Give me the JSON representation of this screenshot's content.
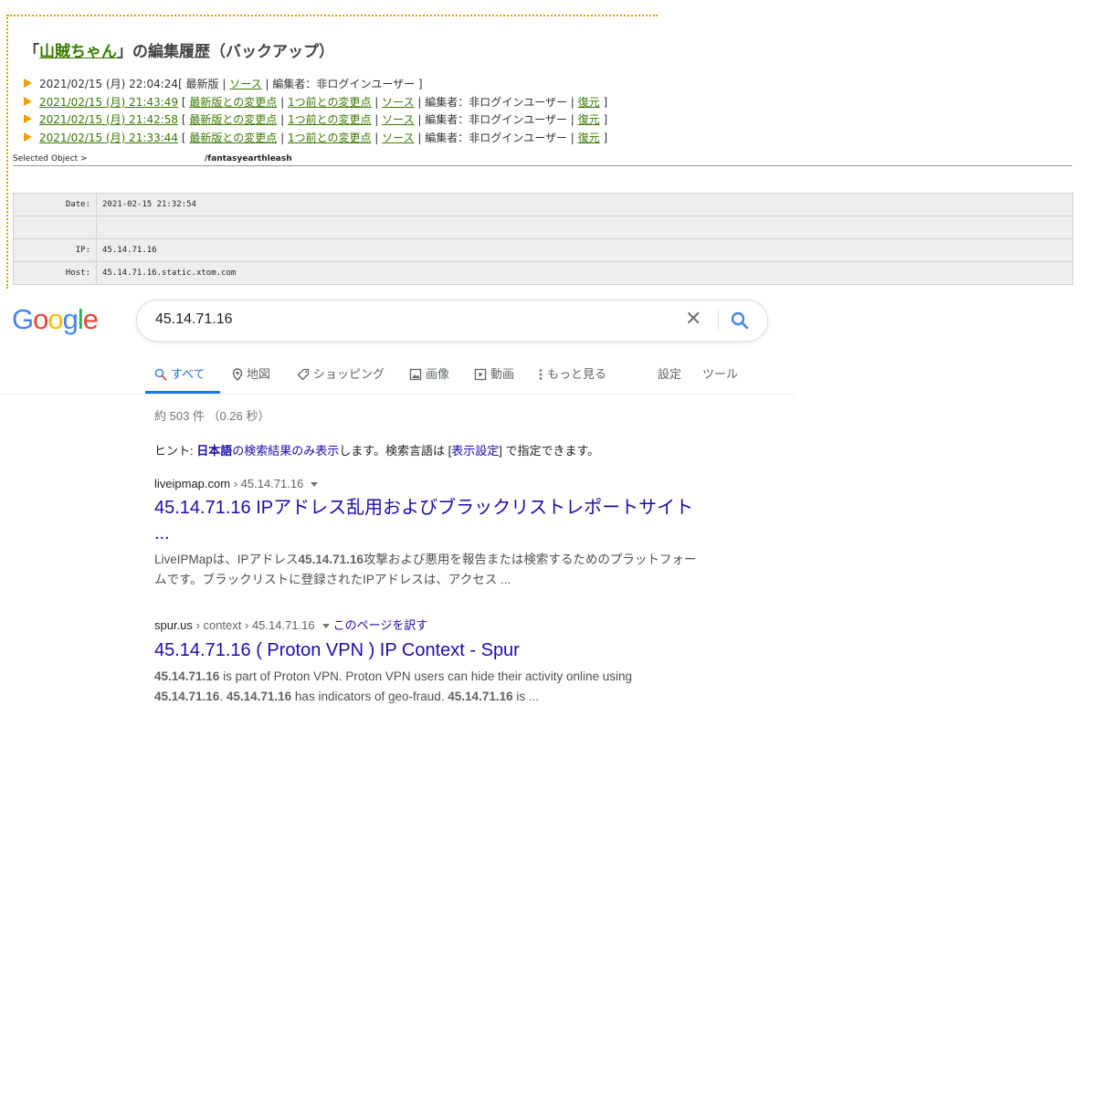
{
  "wiki": {
    "title_prefix": "「",
    "title_link": "山賊ちゃん",
    "title_suffix": "」の編集履歴（バックアップ）",
    "history": [
      {
        "date": "2021/02/15 (月) 22:04:24",
        "date_linked": false,
        "text": "[ 最新版 | ",
        "diff_latest": "",
        "sep1": "",
        "diff_prev": "",
        "sep2": "",
        "source": "ソース",
        "editor": " | 編集者：非ログインユーザー ]",
        "restore": ""
      },
      {
        "date": "2021/02/15 (月) 21:43:49",
        "date_linked": true,
        "text": " [ ",
        "diff_latest": "最新版との変更点",
        "sep1": " | ",
        "diff_prev": "1つ前との変更点",
        "sep2": " | ",
        "source": "ソース",
        "editor": " | 編集者：非ログインユーザー | ",
        "restore": "復元"
      },
      {
        "date": "2021/02/15 (月) 21:42:58",
        "date_linked": true,
        "text": " [ ",
        "diff_latest": "最新版との変更点",
        "sep1": " | ",
        "diff_prev": "1つ前との変更点",
        "sep2": " | ",
        "source": "ソース",
        "editor": " | 編集者：非ログインユーザー | ",
        "restore": "復元"
      },
      {
        "date": "2021/02/15 (月) 21:33:44",
        "date_linked": true,
        "text": " [ ",
        "diff_latest": "最新版との変更点",
        "sep1": " | ",
        "diff_prev": "1つ前との変更点",
        "sep2": " | ",
        "source": "ソース",
        "editor": " | 編集者：非ログインユーザー | ",
        "restore": "復元"
      }
    ],
    "selected_object_label": "Selected Object >",
    "selected_object_value": "/fantasyearthleash",
    "info_rows": [
      {
        "key": "Date:",
        "value": "2021-02-15 21:32:54"
      },
      {
        "key": "",
        "value": ""
      },
      {
        "key": "IP:",
        "value": "45.14.71.16"
      },
      {
        "key": "Host:",
        "value": "45.14.71.16.static.xtom.com"
      }
    ]
  },
  "google": {
    "logo_letters": [
      "G",
      "o",
      "o",
      "g",
      "l",
      "e"
    ],
    "logo_colors": [
      "#4285F4",
      "#EA4335",
      "#FBBC05",
      "#4285F4",
      "#34A853",
      "#EA4335"
    ],
    "query": "45.14.71.16",
    "tabs": [
      {
        "label": "すべて",
        "icon": "search-icon"
      },
      {
        "label": "地図",
        "icon": "map-pin-icon"
      },
      {
        "label": "ショッピング",
        "icon": "tag-icon"
      },
      {
        "label": "画像",
        "icon": "image-icon"
      },
      {
        "label": "動画",
        "icon": "video-icon"
      },
      {
        "label": "もっと見る",
        "icon": "more-vertical-icon"
      },
      {
        "label": "設定",
        "icon": ""
      },
      {
        "label": "ツール",
        "icon": ""
      }
    ],
    "stats": "約 503 件 （0.26 秒）",
    "hint": {
      "prefix": "ヒント: ",
      "link1": "日本語",
      "link2": "の検索結果のみ表示",
      "middle": "します。検索言語は [",
      "link3": "表示設定",
      "suffix": "] で指定できます。"
    },
    "results": [
      {
        "domain": "liveipmap.com",
        "crumbs": " › 45.14.71.16",
        "translate": "",
        "title": "45.14.71.16 IPアドレス乱用およびブラックリストレポートサイト ...",
        "snippet_parts": [
          {
            "t": "LiveIPMapは、IPアドレス",
            "b": false
          },
          {
            "t": "45.14.71.16",
            "b": true
          },
          {
            "t": "攻撃および悪用を報告または検索するためのプラットフォームです。ブラックリストに登録されたIPアドレスは、アクセス ...",
            "b": false
          }
        ]
      },
      {
        "domain": "spur.us",
        "crumbs": " › context › 45.14.71.16",
        "translate": "このページを訳す",
        "title": "45.14.71.16 ( Proton VPN ) IP Context - Spur",
        "snippet_parts": [
          {
            "t": "45.14.71.16",
            "b": true
          },
          {
            "t": " is part of Proton VPN. Proton VPN users can hide their activity online using ",
            "b": false
          },
          {
            "t": "45.14.71.16",
            "b": true
          },
          {
            "t": ". ",
            "b": false
          },
          {
            "t": "45.14.71.16",
            "b": true
          },
          {
            "t": " has indicators of geo-fraud. ",
            "b": false
          },
          {
            "t": "45.14.71.16",
            "b": true
          },
          {
            "t": " is ...",
            "b": false
          }
        ]
      }
    ]
  }
}
